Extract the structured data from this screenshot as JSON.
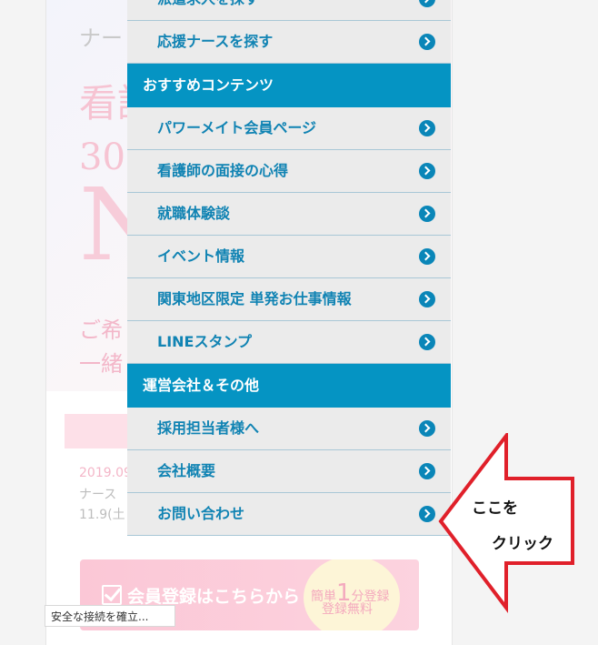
{
  "background_page": {
    "hero_line1": "ナー",
    "hero_line2": "看護",
    "hero_line3": "30",
    "hero_big_letter": "N",
    "hero_line5": "ご希",
    "hero_line6": "一緒",
    "news_date": "2019.09",
    "news_line2": "ナース",
    "news_line3": "11.9(土",
    "register_banner": {
      "label": "会員登録はこちらから",
      "circle_prefix": "簡単",
      "circle_number": "1",
      "circle_suffix": "分登録",
      "circle_line2": "登録無料"
    }
  },
  "menu": {
    "items_top": [
      {
        "label": "派遣求人を探す"
      },
      {
        "label": "応援ナースを探す"
      }
    ],
    "section1": {
      "label": "おすすめコンテンツ"
    },
    "items_mid": [
      {
        "label": "パワーメイト会員ページ"
      },
      {
        "label": "看護師の面接の心得"
      },
      {
        "label": "就職体験談"
      },
      {
        "label": "イベント情報"
      },
      {
        "label": "関東地区限定 単発お仕事情報"
      },
      {
        "label": "LINEスタンプ"
      }
    ],
    "section2": {
      "label": "運営会社＆その他"
    },
    "items_bottom": [
      {
        "label": "採用担当者様へ"
      },
      {
        "label": "会社概要"
      },
      {
        "label": "お問い合わせ"
      }
    ]
  },
  "annotation": {
    "line1": "ここを",
    "line2": "クリック",
    "arrow_stroke": "#e0202a"
  },
  "status_bar": {
    "text": "安全な接続を確立..."
  }
}
